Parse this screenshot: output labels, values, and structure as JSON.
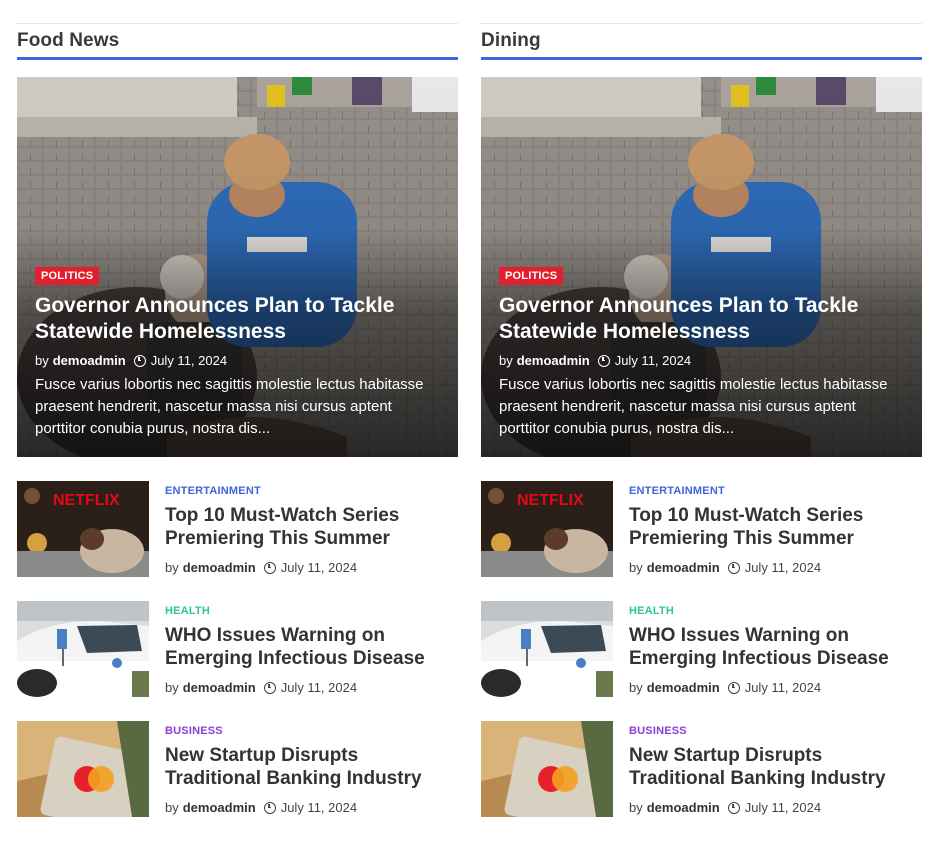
{
  "columns": [
    {
      "heading": "Food News",
      "featured": {
        "category": "POLITICS",
        "title": "Governor Announces Plan to Tackle Statewide Homelessness",
        "by": "by",
        "author": "demoadmin",
        "date": "July 11, 2024",
        "excerpt": "Fusce varius lobortis nec sagittis molestie lectus habitasse praesent hendrerit, nascetur massa nisi cursus aptent porttitor conubia purus, nostra dis..."
      },
      "items": [
        {
          "category": "ENTERTAINMENT",
          "category_color": "#3f64dc",
          "title": "Top 10 Must-Watch Series Premiering This Summer",
          "by": "by",
          "author": "demoadmin",
          "date": "July 11, 2024",
          "thumb": "netflix"
        },
        {
          "category": "HEALTH",
          "category_color": "#2ec4a0",
          "title": "WHO Issues Warning on Emerging Infectious Disease",
          "by": "by",
          "author": "demoadmin",
          "date": "July 11, 2024",
          "thumb": "car"
        },
        {
          "category": "BUSINESS",
          "category_color": "#8a3fd1",
          "title": "New Startup Disrupts Traditional Banking Industry",
          "by": "by",
          "author": "demoadmin",
          "date": "July 11, 2024",
          "thumb": "cards"
        }
      ]
    },
    {
      "heading": "Dining",
      "featured": {
        "category": "POLITICS",
        "title": "Governor Announces Plan to Tackle Statewide Homelessness",
        "by": "by",
        "author": "demoadmin",
        "date": "July 11, 2024",
        "excerpt": "Fusce varius lobortis nec sagittis molestie lectus habitasse praesent hendrerit, nascetur massa nisi cursus aptent porttitor conubia purus, nostra dis..."
      },
      "items": [
        {
          "category": "ENTERTAINMENT",
          "category_color": "#3f64dc",
          "title": "Top 10 Must-Watch Series Premiering This Summer",
          "by": "by",
          "author": "demoadmin",
          "date": "July 11, 2024",
          "thumb": "netflix"
        },
        {
          "category": "HEALTH",
          "category_color": "#2ec4a0",
          "title": "WHO Issues Warning on Emerging Infectious Disease",
          "by": "by",
          "author": "demoadmin",
          "date": "July 11, 2024",
          "thumb": "car"
        },
        {
          "category": "BUSINESS",
          "category_color": "#8a3fd1",
          "title": "New Startup Disrupts Traditional Banking Industry",
          "by": "by",
          "author": "demoadmin",
          "date": "July 11, 2024",
          "thumb": "cards"
        }
      ]
    }
  ],
  "thumb_logo_text": "NETFLIX",
  "colors": {
    "accent": "#3f64dc",
    "politics_badge": "#e0202e"
  }
}
